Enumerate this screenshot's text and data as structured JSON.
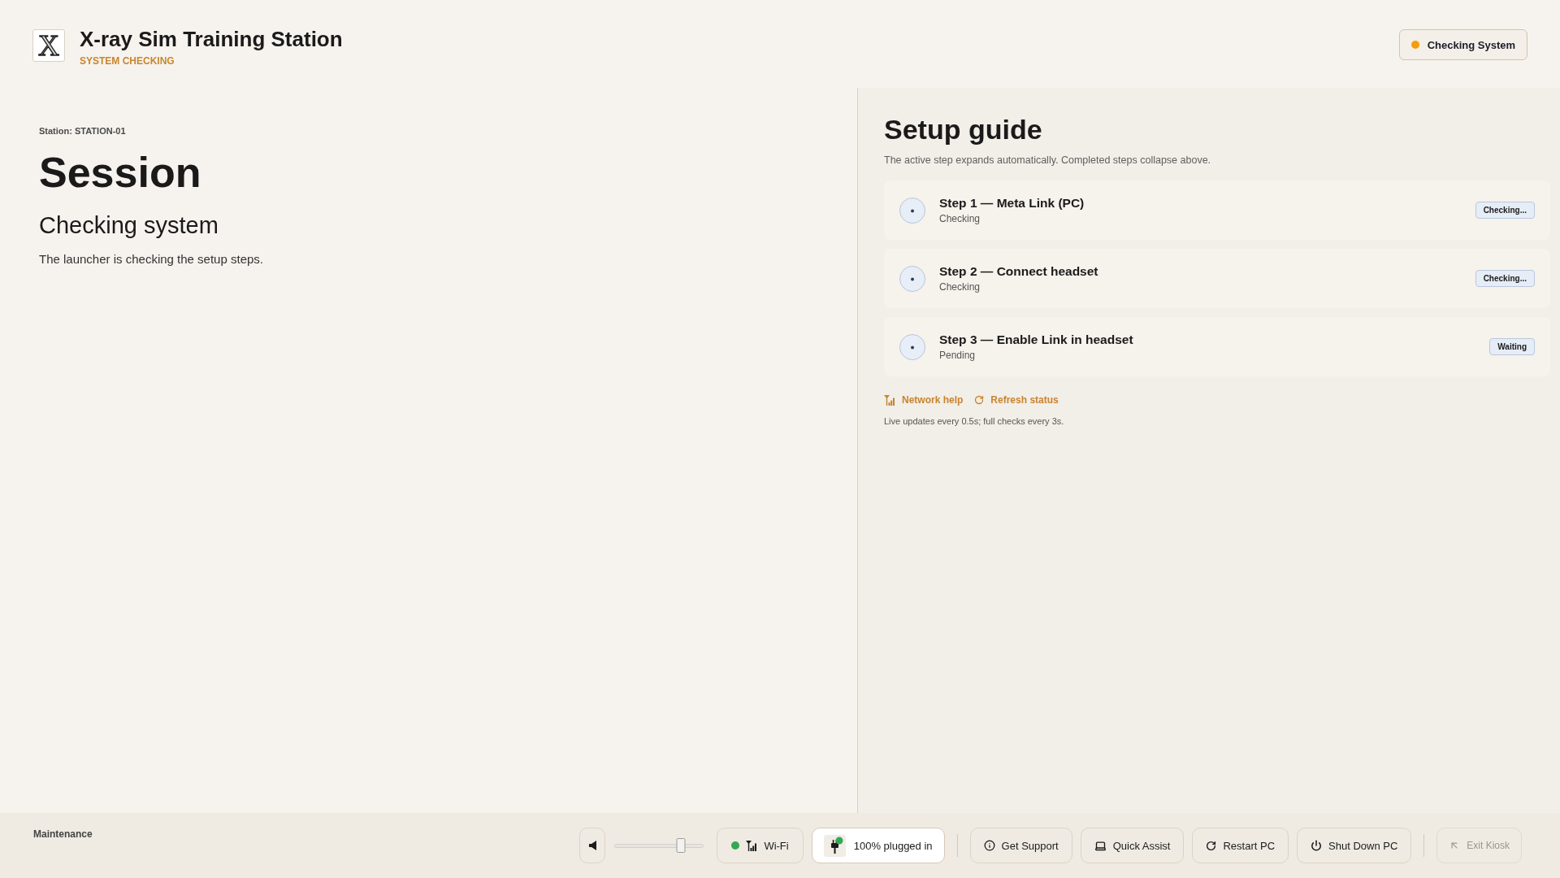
{
  "header": {
    "logo": "X",
    "title": "X-ray Sim Training Station",
    "subtitle": "SYSTEM CHECKING",
    "status": {
      "label": "Checking System",
      "color": "#f59e0b"
    }
  },
  "session": {
    "station": "Station: STATION-01",
    "title": "Session",
    "state": "Checking system",
    "message": "The launcher is checking the setup steps."
  },
  "setup_guide": {
    "title": "Setup guide",
    "subtitle": "The active step expands automatically. Completed steps collapse above.",
    "steps": [
      {
        "title": "Step 1 — Meta Link (PC)",
        "status": "Checking",
        "badge": "Checking..."
      },
      {
        "title": "Step 2 — Connect headset",
        "status": "Checking",
        "badge": "Checking..."
      },
      {
        "title": "Step 3 — Enable Link in headset",
        "status": "Pending",
        "badge": "Waiting"
      }
    ],
    "links": [
      {
        "kind": "network",
        "label": "Network help"
      },
      {
        "kind": "refresh",
        "label": "Refresh status"
      }
    ],
    "note": "Live updates every 0.5s; full checks every 3s."
  },
  "footer": {
    "label": "Maintenance",
    "volume": {
      "level": 0.75
    },
    "wifi": {
      "label": "Wi-Fi",
      "color": "#34a853"
    },
    "battery": {
      "label": "100% plugged in",
      "color": "#34a853"
    },
    "actions": [
      {
        "kind": "support",
        "label": "Get Support",
        "disabled": false
      },
      {
        "kind": "assist",
        "label": "Quick Assist",
        "disabled": false
      },
      {
        "kind": "restart",
        "label": "Restart PC",
        "disabled": false
      },
      {
        "kind": "shutdown",
        "label": "Shut Down PC",
        "disabled": false
      },
      {
        "kind": "exit",
        "label": "Exit Kiosk",
        "disabled": true
      }
    ]
  }
}
